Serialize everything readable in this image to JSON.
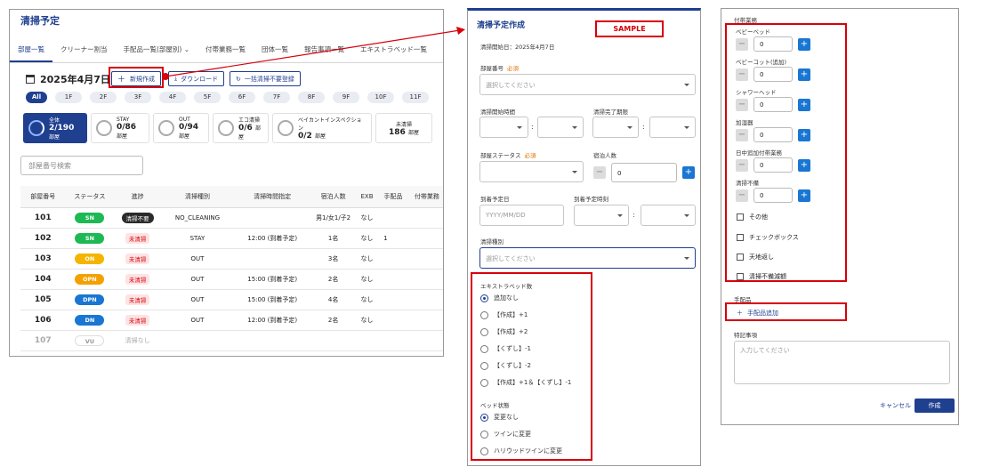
{
  "main": {
    "title": "清掃予定",
    "tabs": [
      "部屋一覧",
      "クリーナー割当",
      "手配品一覧(部屋別)",
      "付帯業務一覧",
      "団体一覧",
      "報告事項一覧",
      "エキストラベッド一覧"
    ],
    "date": "2025年4月7日",
    "buttons": {
      "new": "新規作成",
      "download": "ダウンロード",
      "bulk": "一括清掃不要登録"
    },
    "floors": [
      "All",
      "1F",
      "2F",
      "3F",
      "4F",
      "5F",
      "6F",
      "7F",
      "8F",
      "9F",
      "10F",
      "11F"
    ],
    "cards": [
      {
        "label": "全体",
        "value": "2/190",
        "unit": "部屋"
      },
      {
        "label": "STAY",
        "value": "0/86",
        "unit": "部屋"
      },
      {
        "label": "OUT",
        "value": "0/94",
        "unit": "部屋"
      },
      {
        "label": "エコ清掃",
        "value": "0/6",
        "unit": "部屋"
      },
      {
        "label": "ベイカントインスペクション",
        "value": "0/2",
        "unit": "部屋"
      },
      {
        "label": "未清掃",
        "value": "186",
        "unit": "部屋"
      }
    ],
    "search_placeholder": "部屋番号検索",
    "headers": [
      "部屋番号",
      "ステータス",
      "進捗",
      "清掃種別",
      "清掃時間指定",
      "宿泊人数",
      "EXB",
      "手配品",
      "付帯業務"
    ],
    "rows": [
      {
        "room": "101",
        "status": "SN",
        "status_color": "#1db954",
        "progress": "清掃不要",
        "progress_style": "dark",
        "type": "NO_CLEANING",
        "time": "",
        "guests": "男1/女1/子2",
        "exb": "なし",
        "items": ""
      },
      {
        "room": "102",
        "status": "SN",
        "status_color": "#1db954",
        "progress": "未清掃",
        "progress_style": "red",
        "type": "STAY",
        "time": "12:00 (到着予定)",
        "guests": "1名",
        "exb": "なし",
        "items": "1"
      },
      {
        "room": "103",
        "status": "ON",
        "status_color": "#f4b400",
        "progress": "未清掃",
        "progress_style": "red",
        "type": "OUT",
        "time": "",
        "guests": "3名",
        "exb": "なし",
        "items": ""
      },
      {
        "room": "104",
        "status": "OPN",
        "status_color": "#f4a000",
        "progress": "未清掃",
        "progress_style": "red",
        "type": "OUT",
        "time": "15:00 (到着予定)",
        "guests": "2名",
        "exb": "なし",
        "items": ""
      },
      {
        "room": "105",
        "status": "DPN",
        "status_color": "#1976d2",
        "progress": "未清掃",
        "progress_style": "red",
        "type": "OUT",
        "time": "15:00 (到着予定)",
        "guests": "4名",
        "exb": "なし",
        "items": ""
      },
      {
        "room": "106",
        "status": "DN",
        "status_color": "#1976d2",
        "progress": "未清掃",
        "progress_style": "red",
        "type": "OUT",
        "time": "12:00 (到着予定)",
        "guests": "2名",
        "exb": "なし",
        "items": ""
      },
      {
        "room": "107",
        "status": "VU",
        "status_color": "#ffffff",
        "progress": "清掃なし",
        "progress_style": "plain",
        "type": "",
        "time": "",
        "guests": "",
        "exb": "",
        "items": ""
      }
    ]
  },
  "form": {
    "title": "清掃予定作成",
    "sample": "SAMPLE",
    "start_date": "清掃開始日：2025年4月7日",
    "room_label": "部屋番号",
    "required": "必須",
    "room_placeholder": "選択してください",
    "start_time_label": "清掃開始時間",
    "end_time_label": "清掃完了期限",
    "room_status_label": "部屋ステータス",
    "guests_label": "宿泊人数",
    "guests_value": "0",
    "arrival_date_label": "到着予定日",
    "arrival_date_placeholder": "YYYY/MM/DD",
    "arrival_time_label": "到着予定時刻",
    "type_label": "清掃種別",
    "type_placeholder": "選択してください",
    "extra_bed_label": "エキストラベッド数",
    "extra_bed_options": [
      "追加なし",
      "【作成】+1",
      "【作成】+2",
      "【くずし】-1",
      "【くずし】-2",
      "【作成】+1＆【くずし】-1"
    ],
    "bed_state_label": "ベッド状態",
    "bed_state_options": [
      "変更なし",
      "ツインに変更",
      "ハリウッドツインに変更"
    ]
  },
  "form2": {
    "section_label": "付帯業務",
    "steppers": [
      {
        "label": "ベビーベッド",
        "value": "0"
      },
      {
        "label": "ベビーコット(追加)",
        "value": "0"
      },
      {
        "label": "シャワーヘッド",
        "value": "0"
      },
      {
        "label": "加湿器",
        "value": "0"
      },
      {
        "label": "日中追加付帯業務",
        "value": "0"
      },
      {
        "label": "清掃不備",
        "value": "0"
      }
    ],
    "checks": [
      "その他",
      "チェックボックス",
      "天地返し",
      "清掃不備減額"
    ],
    "items_label": "手配品",
    "add_item": "手配品追加",
    "notes_label": "特記事項",
    "notes_placeholder": "入力してください",
    "cancel": "キャンセル",
    "create": "作成"
  },
  "colors": {
    "accent": "#1f3f8f",
    "highlight": "#d8000c",
    "plus": "#1976d2"
  },
  "icons": {
    "calendar": "calendar-icon",
    "plus": "plus-icon",
    "download": "download-icon",
    "refresh": "refresh-icon",
    "caret": "chevron-down-icon"
  }
}
